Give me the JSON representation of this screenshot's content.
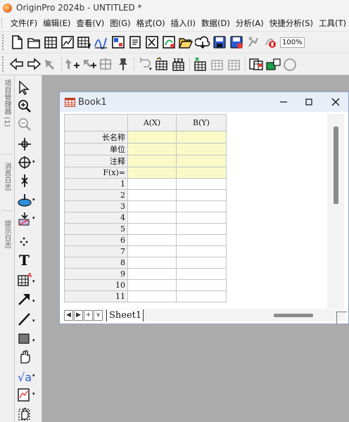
{
  "window": {
    "title": "OriginPro 2024b - UNTITLED *"
  },
  "menu": [
    "文件(F)",
    "编辑(E)",
    "查看(V)",
    "图(G)",
    "格式(O)",
    "插入(I)",
    "数据(D)",
    "分析(A)",
    "快捷分析(S)",
    "工具(T)"
  ],
  "toolbar": {
    "zoom": "100%"
  },
  "left_panels": [
    {
      "label": "项目管理器 (1)"
    },
    {
      "label": "消息日志"
    },
    {
      "label": "提示日志"
    }
  ],
  "book": {
    "title": "Book1",
    "columns": [
      "A(X)",
      "B(Y)"
    ],
    "meta_rows": [
      "长名称",
      "单位",
      "注释",
      "F(x)="
    ],
    "rows": [
      "1",
      "2",
      "3",
      "4",
      "5",
      "6",
      "7",
      "8",
      "9",
      "10",
      "11"
    ],
    "sheet_tab": "Sheet1",
    "nav_buttons": [
      "◀",
      "▶",
      "+",
      "∨"
    ]
  },
  "colors": {
    "meta_row_fill": "#fafac8",
    "window_title_bg": "#e7eef8",
    "workspace_bg": "#ababab"
  }
}
